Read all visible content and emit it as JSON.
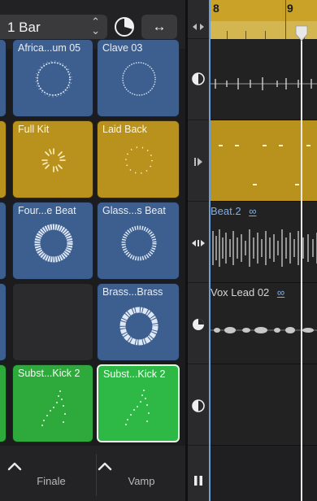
{
  "toolbar": {
    "quantize_value": "1 Bar",
    "quantize_arrows_icon": "up-down-chevrons",
    "time_dial_icon": "dial-icon",
    "swap_icon": "↔"
  },
  "cells": [
    {
      "row": 0,
      "col": 0,
      "label": "Africa...um 05",
      "color": "#3d5f8f"
    },
    {
      "row": 0,
      "col": 1,
      "label": "Clave 03",
      "color": "#3d5f8f"
    },
    {
      "row": 1,
      "col": 0,
      "label": "Full Kit",
      "color": "#b9921e"
    },
    {
      "row": 1,
      "col": 1,
      "label": "Laid Back",
      "color": "#b9921e"
    },
    {
      "row": 2,
      "col": 0,
      "label": "Four...e Beat",
      "color": "#3d5f8f"
    },
    {
      "row": 2,
      "col": 1,
      "label": "Glass...s Beat",
      "color": "#3d5f8f"
    },
    {
      "row": 3,
      "col": 1,
      "label": "Brass...Brass",
      "color": "#3d5f8f"
    },
    {
      "row": 4,
      "col": 0,
      "label": "Subst...Kick 2",
      "color": "#2eaa3c"
    },
    {
      "row": 4,
      "col": 1,
      "label": "Subst...Kick 2",
      "color": "#2eb845",
      "selected": true
    }
  ],
  "scene_triggers": [
    {
      "label": "Finale",
      "icon": "chevron-up-icon"
    },
    {
      "label": "Vamp",
      "icon": "chevron-up-icon"
    }
  ],
  "ruler": {
    "bar_a": "8",
    "bar_b": "9",
    "color": "#c9a227"
  },
  "regions": {
    "beat": {
      "name": "Beat.2",
      "loop_icon": "∞"
    },
    "vox": {
      "name": "Vox Lead 02",
      "loop_icon": "∞"
    }
  },
  "colors": {
    "blue_cell": "#3d5f8f",
    "gold_cell": "#b9921e",
    "green_cell": "#2eaa3c",
    "ruler": "#c9a227",
    "timeline_border": "#6a9fd8"
  }
}
